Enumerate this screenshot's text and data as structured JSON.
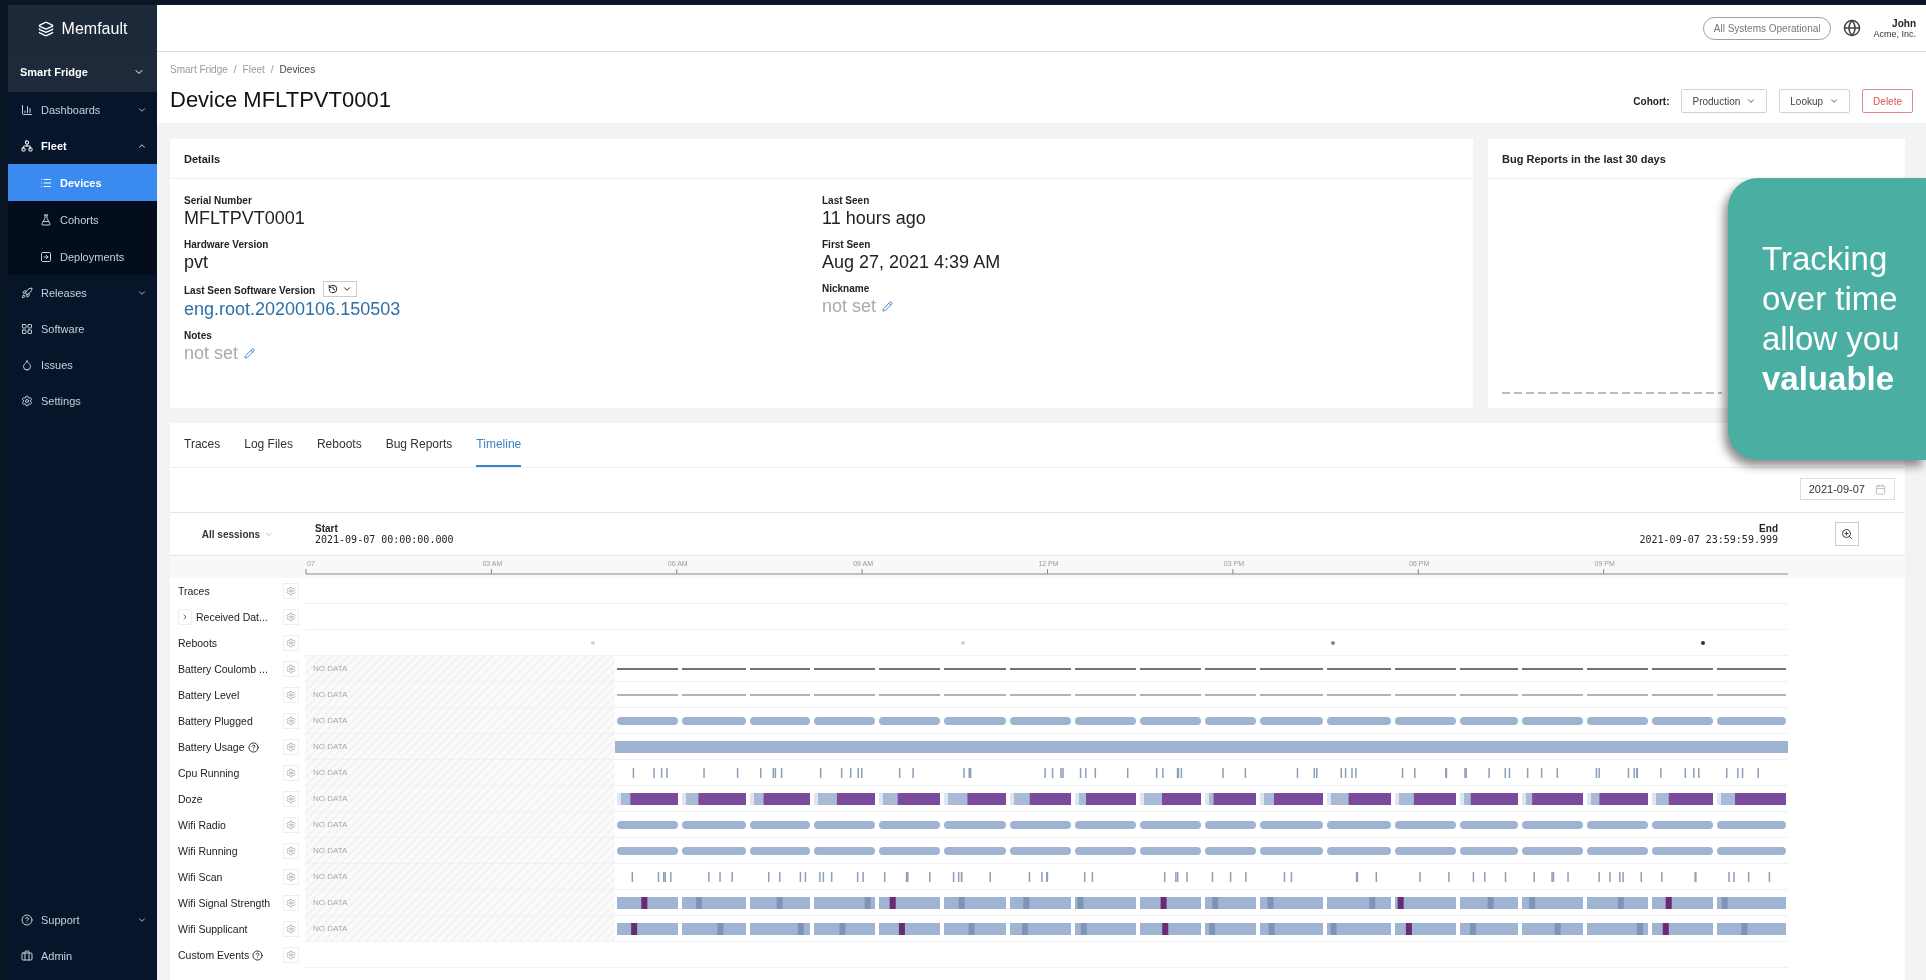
{
  "sidebar": {
    "logo": "Memfault",
    "project": "Smart Fridge",
    "items": [
      {
        "label": "Dashboards",
        "kind": "group",
        "expanded": false
      },
      {
        "label": "Fleet",
        "kind": "group",
        "expanded": true,
        "children": [
          {
            "label": "Devices",
            "selected": true
          },
          {
            "label": "Cohorts",
            "selected": false
          },
          {
            "label": "Deployments",
            "selected": false
          }
        ]
      },
      {
        "label": "Releases",
        "kind": "group",
        "expanded": false
      },
      {
        "label": "Software",
        "kind": "link"
      },
      {
        "label": "Issues",
        "kind": "link"
      },
      {
        "label": "Settings",
        "kind": "link"
      }
    ],
    "footer_items": [
      {
        "label": "Support",
        "kind": "group",
        "expanded": false
      },
      {
        "label": "Admin",
        "kind": "link"
      }
    ]
  },
  "topbar": {
    "status": "All Systems Operational",
    "user_name": "John",
    "org": "Acme, Inc."
  },
  "breadcrumb": [
    {
      "text": "Smart Fridge",
      "kind": "link"
    },
    {
      "text": "/",
      "kind": "separator"
    },
    {
      "text": "Fleet",
      "kind": "link"
    },
    {
      "text": "/",
      "kind": "separator"
    },
    {
      "text": "Devices",
      "kind": "current"
    }
  ],
  "title": "Device MFLTPVT0001",
  "actions": {
    "cohort_label": "Cohort:",
    "cohort_value": "Production",
    "lookup": "Lookup",
    "delete": "Delete"
  },
  "details": {
    "title": "Details",
    "left": [
      {
        "label": "Serial Number",
        "value": "MFLTPVT0001",
        "kind": "text"
      },
      {
        "label": "Hardware Version",
        "value": "pvt",
        "kind": "text"
      },
      {
        "label": "Last Seen Software Version",
        "value": "eng.root.20200106.150503",
        "kind": "link"
      },
      {
        "label": "Notes",
        "value": "not set",
        "kind": "empty"
      }
    ],
    "right": [
      {
        "label": "Last Seen",
        "value": "11 hours ago",
        "kind": "text"
      },
      {
        "label": "First Seen",
        "value": "Aug 27, 2021 4:39 AM",
        "kind": "text"
      },
      {
        "label": "Nickname",
        "value": "not set",
        "kind": "empty"
      }
    ]
  },
  "bug_reports": {
    "title": "Bug Reports in the last 30 days"
  },
  "callout": [
    "Tracking",
    "over time",
    "allow you",
    "valuable"
  ],
  "tabs": [
    {
      "label": "Traces",
      "selected": false
    },
    {
      "label": "Log Files",
      "selected": false
    },
    {
      "label": "Reboots",
      "selected": false
    },
    {
      "label": "Bug Reports",
      "selected": false
    },
    {
      "label": "Timeline",
      "selected": true
    }
  ],
  "timeline": {
    "date": "2021-09-07",
    "sessions": "All sessions",
    "start_label": "Start",
    "start": "2021-09-07 00:00:00.000",
    "end_label": "End",
    "end": "2021-09-07 23:59:59.999",
    "ticks": [
      "07",
      "03 AM",
      "06 AM",
      "09 AM",
      "12 PM",
      "03 PM",
      "06 PM",
      "09 PM"
    ],
    "rows": [
      {
        "label": "Traces",
        "kind": "empty",
        "help": false
      },
      {
        "label": "Received Dat...",
        "kind": "empty",
        "help": false,
        "expanded": false
      },
      {
        "label": "Reboots",
        "kind": "markers",
        "help": false
      },
      {
        "label": "Battery Coulomb ...",
        "kind": "line",
        "help": false,
        "no_data": "NO DATA"
      },
      {
        "label": "Battery Level",
        "kind": "line",
        "help": false,
        "no_data": "NO DATA"
      },
      {
        "label": "Battery Plugged",
        "kind": "pill",
        "help": false,
        "no_data": "NO DATA"
      },
      {
        "label": "Battery Usage",
        "kind": "solid",
        "help": true,
        "no_data": "NO DATA"
      },
      {
        "label": "Cpu Running",
        "kind": "ticks",
        "help": false,
        "no_data": "NO DATA"
      },
      {
        "label": "Doze",
        "kind": "doze",
        "help": false,
        "no_data": "NO DATA"
      },
      {
        "label": "Wifi Radio",
        "kind": "pill",
        "help": false,
        "no_data": "NO DATA"
      },
      {
        "label": "Wifi Running",
        "kind": "pill",
        "help": false,
        "no_data": "NO DATA"
      },
      {
        "label": "Wifi Scan",
        "kind": "ticks",
        "help": false,
        "no_data": "NO DATA"
      },
      {
        "label": "Wifi Signal Strength",
        "kind": "signal",
        "help": false,
        "no_data": "NO DATA"
      },
      {
        "label": "Wifi Supplicant",
        "kind": "signal",
        "help": false,
        "no_data": "NO DATA"
      },
      {
        "label": "Custom Events",
        "kind": "empty",
        "help": true
      }
    ]
  }
}
